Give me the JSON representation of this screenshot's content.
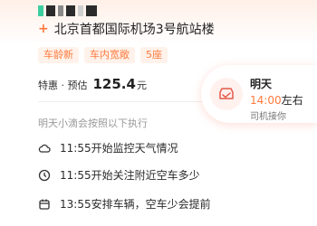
{
  "trip": {
    "destination": "北京首都国际机场3号航站楼",
    "plus_symbol": "+",
    "tags": [
      "车龄新",
      "车内宽敞",
      "5座"
    ],
    "price_prefix": "特惠 · 预估",
    "price_amount": "125.4",
    "price_unit": "元"
  },
  "schedule": {
    "title": "明天小滴会按照以下执行",
    "items": [
      {
        "icon": "cloud-icon",
        "text": "11:55开始监控天气情况"
      },
      {
        "icon": "clock-icon",
        "text": "11:55开始关注附近空车多少"
      },
      {
        "icon": "calendar-icon",
        "text": "13:55安排车辆，空车少会提前"
      }
    ]
  },
  "pickup_card": {
    "day": "明天",
    "time": "14:00",
    "time_suffix": "左右",
    "note": "司机接你",
    "icon": "car-badge-icon"
  },
  "colors": {
    "accent": "#ff7a3d",
    "tag_bg": "#fff2ea"
  }
}
